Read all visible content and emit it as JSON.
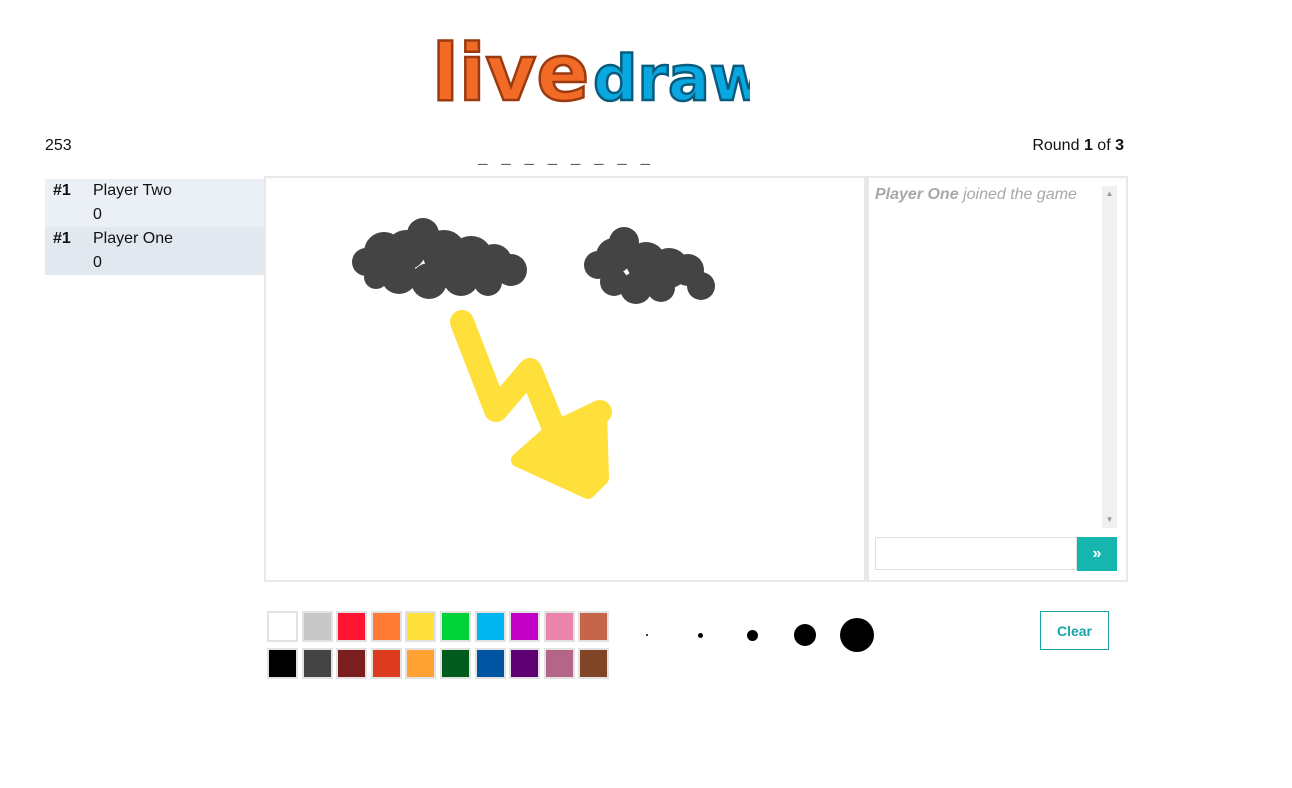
{
  "logo": {
    "word1": "live",
    "word2": "draw",
    "color1": "#f26b26",
    "color2": "#0aa8e0"
  },
  "game": {
    "timer": "253",
    "word_blanks": "_ _ _ _ _ _ _ _ _",
    "round_label": "Round",
    "round_current": "1",
    "round_of": "of",
    "round_total": "3"
  },
  "players": [
    {
      "rank": "#1",
      "name": "Player Two",
      "score": "0"
    },
    {
      "rank": "#1",
      "name": "Player One",
      "score": "0"
    }
  ],
  "chat": {
    "messages": [
      {
        "user": "Player One",
        "text": "joined the game"
      }
    ],
    "input_value": "",
    "send_label": "»"
  },
  "palette": {
    "row1": [
      "#ffffff",
      "#c8c8c8",
      "#ff1533",
      "#ff7a35",
      "#ffe03c",
      "#00d23a",
      "#00b6ef",
      "#c200c6",
      "#ec83ac",
      "#c5654a"
    ],
    "row2": [
      "#000000",
      "#444444",
      "#7a1e1e",
      "#dd3b1e",
      "#ffa233",
      "#005b1c",
      "#0055a2",
      "#5e0073",
      "#b46688",
      "#7e4527"
    ]
  },
  "brush_sizes": [
    "tiny",
    "small",
    "medium",
    "large",
    "x-large"
  ],
  "controls": {
    "clear_label": "Clear"
  },
  "drawing": {
    "cloud_color": "#444444",
    "bolt_color": "#ffdf3a"
  }
}
